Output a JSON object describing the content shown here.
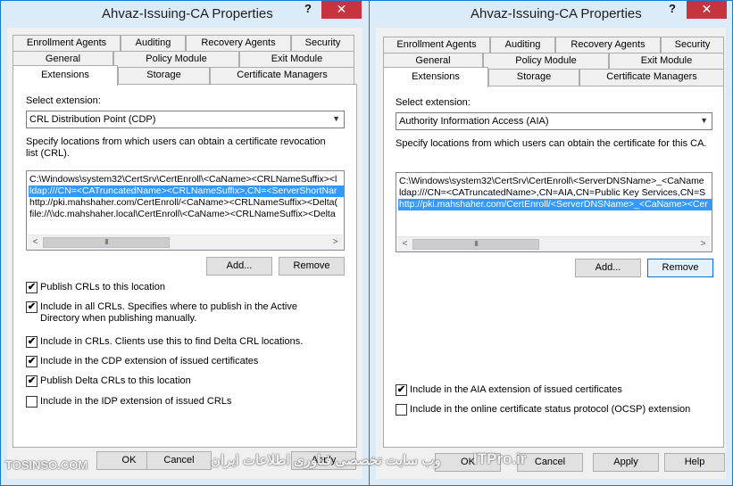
{
  "colors": {
    "title_bar": "#dcebf8",
    "window_border": "#1979ca",
    "close_button": "#c7333f",
    "selection": "#3399ff",
    "focus_border": "#0078d7"
  },
  "icons": {
    "help": "?",
    "close": "✕",
    "dropdown": "▼",
    "scroll_left": "<",
    "scroll_right": ">",
    "scroll_grip": "III",
    "check": "✔"
  },
  "left": {
    "title": "Ahvaz-Issuing-CA Properties",
    "tabs_row1": [
      "Enrollment Agents",
      "Auditing",
      "Recovery Agents",
      "Security"
    ],
    "tabs_row2": [
      "General",
      "Policy Module",
      "Exit Module"
    ],
    "tabs_row3": [
      "Extensions",
      "Storage",
      "Certificate Managers"
    ],
    "select_label": "Select extension:",
    "selected_extension": "CRL Distribution Point (CDP)",
    "description": "Specify locations from which users can obtain a certificate revocation list (CRL).",
    "locations": [
      "C:\\Windows\\system32\\CertSrv\\CertEnroll\\<CaName><CRLNameSuffix><l",
      "ldap:///CN=<CATruncatedName><CRLNameSuffix>,CN=<ServerShortNar",
      "http://pki.mahshaher.com/CertEnroll/<CaName><CRLNameSuffix><Delta(",
      "file://\\\\dc.mahshaher.local\\CertEnroll\\<CaName><CRLNameSuffix><Delta"
    ],
    "selected_location_index": 1,
    "add_label": "Add...",
    "remove_label": "Remove",
    "options": [
      {
        "label": "Publish CRLs to this location",
        "checked": true
      },
      {
        "label": "Include in all CRLs. Specifies where to publish in the Active Directory when publishing manually.",
        "checked": true
      },
      {
        "label": "Include in CRLs. Clients use this to find Delta CRL locations.",
        "checked": true
      },
      {
        "label": "Include in the CDP extension of issued certificates",
        "checked": true
      },
      {
        "label": "Publish Delta CRLs to this location",
        "checked": true
      },
      {
        "label": "Include in the IDP extension of issued CRLs",
        "checked": false
      }
    ],
    "ok_label": "OK",
    "cancel_label": "Cancel",
    "apply_label": "Apply"
  },
  "right": {
    "title": "Ahvaz-Issuing-CA Properties",
    "tabs_row1": [
      "Enrollment Agents",
      "Auditing",
      "Recovery Agents",
      "Security"
    ],
    "tabs_row2": [
      "General",
      "Policy Module",
      "Exit Module"
    ],
    "tabs_row3": [
      "Extensions",
      "Storage",
      "Certificate Managers"
    ],
    "select_label": "Select extension:",
    "selected_extension": "Authority Information Access (AIA)",
    "description": "Specify locations from which users can obtain the certificate for this CA.",
    "locations": [
      "C:\\Windows\\system32\\CertSrv\\CertEnroll\\<ServerDNSName>_<CaName",
      "ldap:///CN=<CATruncatedName>,CN=AIA,CN=Public Key Services,CN=S",
      "http://pki.mahshaher.com/CertEnroll/<ServerDNSName>_<CaName><Cer"
    ],
    "selected_location_index": 2,
    "add_label": "Add...",
    "remove_label": "Remove",
    "options": [
      {
        "label": "Include in the AIA extension of issued certificates",
        "checked": true
      },
      {
        "label": "Include in the online certificate status protocol (OCSP) extension",
        "checked": false
      }
    ],
    "ok_label": "OK",
    "cancel_label": "Cancel",
    "apply_label": "Apply",
    "help_label": "Help"
  },
  "watermark": {
    "left_text": "TOSINSO.COM",
    "middle_text": "وب سایت تخصصی فناوری اطلاعات ایران",
    "itpro_text": "ITPro.ir"
  }
}
